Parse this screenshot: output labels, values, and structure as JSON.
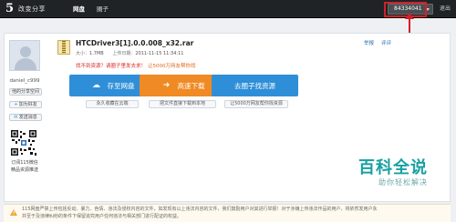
{
  "topbar": {
    "logo_mark": "5",
    "logo_text": "改变分享",
    "tabs": [
      {
        "label": "网盘",
        "active": true
      },
      {
        "label": "圈子",
        "active": false
      }
    ],
    "user_id": "84334041",
    "logout": "退出"
  },
  "profile": {
    "username": "daniel_c999",
    "buttons": [
      {
        "label": "他的分享空间",
        "icon": ""
      },
      {
        "label": "加为好友",
        "icon": "plus-icon"
      },
      {
        "label": "发送消息",
        "icon": "mail-icon"
      }
    ],
    "qr_caption_1": "订阅115微信",
    "qr_caption_2": "精品资源推送"
  },
  "file": {
    "name": "HTCDriver3[1].0.0.008_x32.rar",
    "size_label": "大小：",
    "size": "1.7MB",
    "upload_label": "上传日期：",
    "upload_date": "2011-11-15 11:34:11",
    "warning_red": "找不到资源？请圈子里发去求！",
    "warning_orange": "让5000万网友帮你找",
    "report": "举报",
    "comments": "评评"
  },
  "actions": {
    "save": {
      "label": "存至网盘",
      "icon": "cloud-icon",
      "note": "永久收藏在云端"
    },
    "download": {
      "label": "高速下载",
      "icon": "arrow-right-icon",
      "note": "把文件直接下载到本地"
    },
    "find": {
      "label": "去圈子找资源",
      "icon": "people-icon",
      "note": "让5000万网友帮你找资源"
    }
  },
  "watermark": {
    "title": "百科全说",
    "subtitle": "助你轻松解决"
  },
  "notice": {
    "line1": "115网盘严禁上传包括反动、暴力、色情、违法及侵权内容的文件，如发现有以上违法内容的文件，我们鼓励用户对其进行举报！对于涉嫌上传违法作品的用户，将依然发用户永",
    "line2": "并至于及违律纠纷的条件下保留追究用户任何违法与相关部门进行配证的权益。"
  },
  "colors": {
    "topbar": "#1f2326",
    "highlight": "#d0202a",
    "blue_button": "#2e8fd8",
    "orange_button": "#f08a24",
    "watermark": "#19a0a2"
  }
}
